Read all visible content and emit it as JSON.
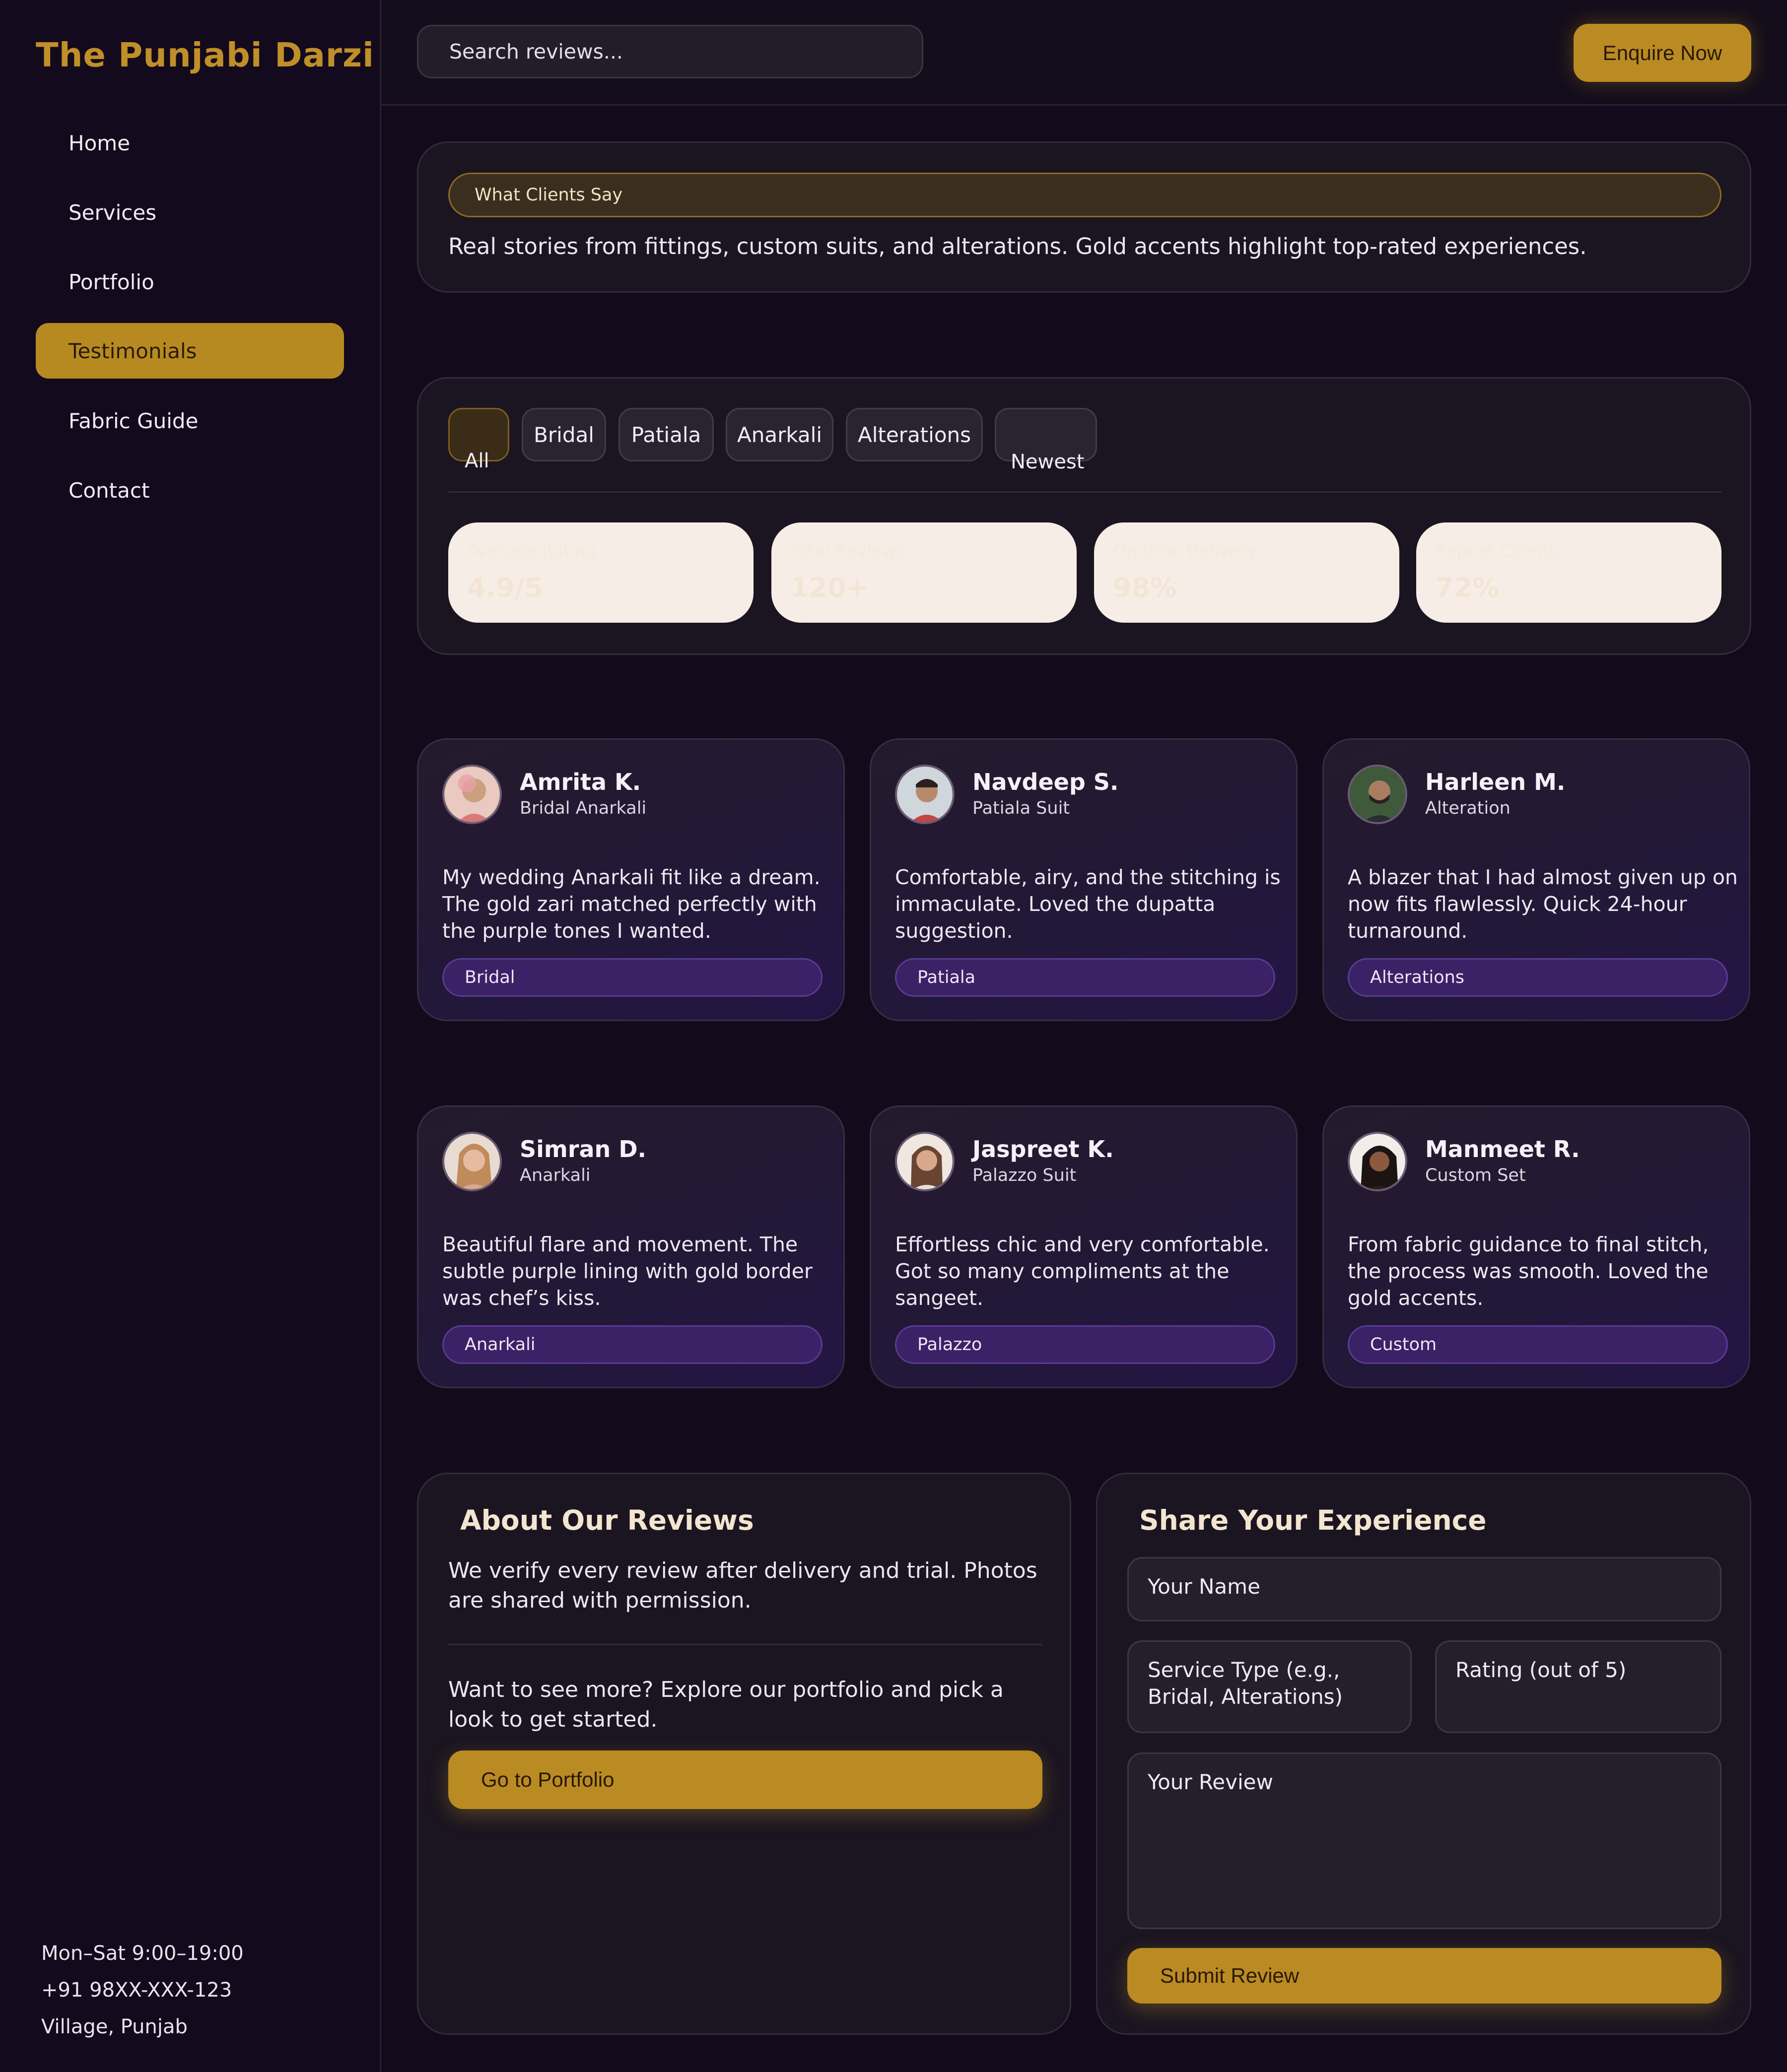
{
  "brand": "The Punjabi Darzi",
  "nav": [
    {
      "label": "Home"
    },
    {
      "label": "Services"
    },
    {
      "label": "Portfolio"
    },
    {
      "label": "Testimonials",
      "active": true
    },
    {
      "label": "Fabric Guide"
    },
    {
      "label": "Contact"
    }
  ],
  "footer": {
    "hours": "Mon–Sat 9:00–19:00",
    "phone": "+91 98XX-XXX-123",
    "location": "Village, Punjab"
  },
  "search": {
    "placeholder": "Search reviews..."
  },
  "header": {
    "enquire_label": "Enquire Now"
  },
  "intro": {
    "label": "What Clients Say",
    "text": "Real stories from fittings, custom suits, and alterations. Gold accents highlight top-rated experiences."
  },
  "filters": {
    "chips": [
      "All",
      "Bridal",
      "Patiala",
      "Anarkali",
      "Alterations"
    ],
    "active": "All",
    "sort": "Newest"
  },
  "stats": [
    {
      "label": "Average Rating",
      "value": "4.9/5"
    },
    {
      "label": "Total Reviews",
      "value": "120+"
    },
    {
      "label": "On-time Delivery",
      "value": "98%"
    },
    {
      "label": "Repeat Clients",
      "value": "72%"
    }
  ],
  "reviews": [
    {
      "name": "Amrita K.",
      "service": "Bridal Anarkali",
      "text": "My wedding Anarkali fit like a dream. The gold zari matched perfectly with the purple tones I wanted.",
      "tag": "Bridal"
    },
    {
      "name": "Navdeep S.",
      "service": "Patiala Suit",
      "text": "Comfortable, airy, and the stitching is immaculate. Loved the dupatta suggestion.",
      "tag": "Patiala"
    },
    {
      "name": "Harleen M.",
      "service": "Alteration",
      "text": "A blazer that I had almost given up on now fits flawlessly. Quick 24-hour turnaround.",
      "tag": "Alterations"
    },
    {
      "name": "Simran D.",
      "service": "Anarkali",
      "text": "Beautiful flare and movement. The subtle purple lining with gold border was chef’s kiss.",
      "tag": "Anarkali"
    },
    {
      "name": "Jaspreet K.",
      "service": "Palazzo Suit",
      "text": "Effortless chic and very comfortable. Got so many compliments at the sangeet.",
      "tag": "Palazzo"
    },
    {
      "name": "Manmeet R.",
      "service": "Custom Set",
      "text": "From fabric guidance to final stitch, the process was smooth. Loved the gold accents.",
      "tag": "Custom"
    }
  ],
  "about": {
    "title": "About Our Reviews",
    "text1": "We verify every review after delivery and trial. Photos are shared with permission.",
    "text2": "Want to see more? Explore our portfolio and pick a look to get started.",
    "button": "Go to Portfolio"
  },
  "form": {
    "title": "Share Your Experience",
    "name_placeholder": "Your Name",
    "service_placeholder": "Service Type (e.g., Bridal, Alterations)",
    "rating_placeholder": "Rating (out of 5)",
    "review_placeholder": "Your Review",
    "submit": "Submit Review"
  },
  "colors": {
    "background": "#130a1b",
    "gold": "#b98b22",
    "purple_tag": "#3b2266"
  }
}
